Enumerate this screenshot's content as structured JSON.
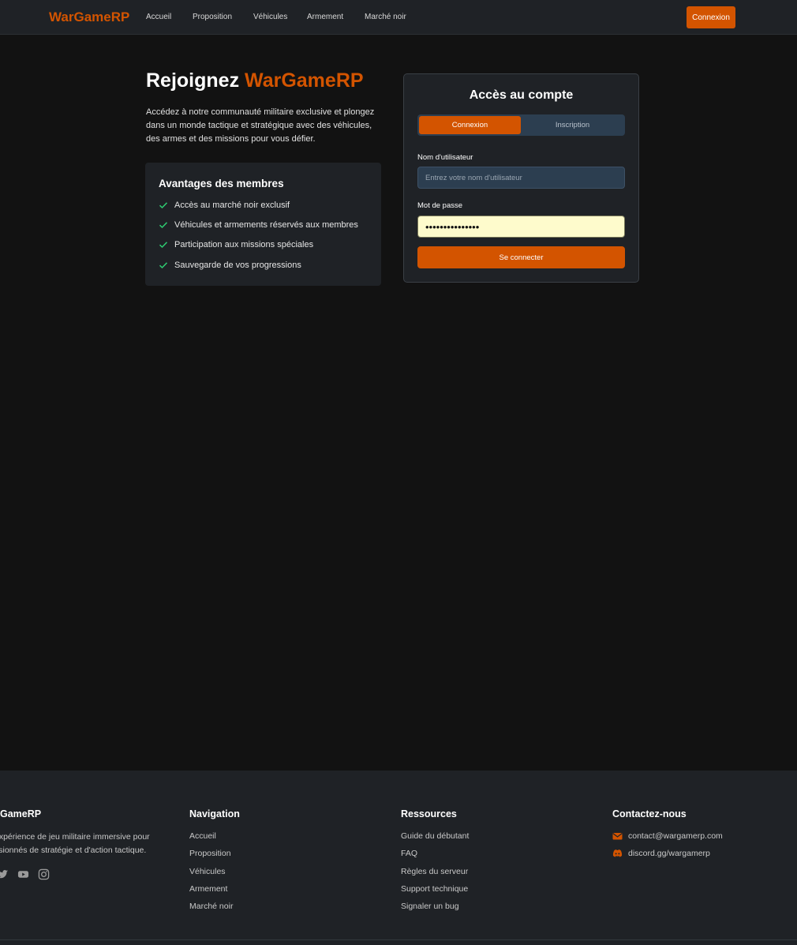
{
  "nav": {
    "brand": "WarGameRP",
    "links": [
      "Accueil",
      "Proposition",
      "Véhicules",
      "Armement",
      "Marché noir"
    ],
    "login_button": "Connexion"
  },
  "hero": {
    "title_prefix": "Rejoignez",
    "title_accent": "WarGameRP",
    "description": "Accédez à notre communauté militaire exclusive et plongez dans un monde tactique et stratégique avec des véhicules, des armes et des missions pour vous défier."
  },
  "benefits": {
    "title": "Avantages des membres",
    "items": [
      "Accès au marché noir exclusif",
      "Véhicules et armements réservés aux membres",
      "Participation aux missions spéciales",
      "Sauvegarde de vos progressions"
    ]
  },
  "login_card": {
    "title": "Accès au compte",
    "tab_login": "Connexion",
    "tab_register": "Inscription",
    "username_label": "Nom d'utilisateur",
    "username_placeholder": "Entrez votre nom d'utilisateur",
    "password_label": "Mot de passe",
    "password_value": "•••••••••••••••",
    "submit": "Se connecter"
  },
  "footer": {
    "brand": "GameRP",
    "description": "expérience de jeu militaire immersive pour ssionnés de stratégie et d'action tactique.",
    "navigation": {
      "title": "Navigation",
      "links": [
        "Accueil",
        "Proposition",
        "Véhicules",
        "Armement",
        "Marché noir"
      ]
    },
    "resources": {
      "title": "Ressources",
      "links": [
        "Guide du débutant",
        "FAQ",
        "Règles du serveur",
        "Support technique",
        "Signaler un bug"
      ]
    },
    "contact": {
      "title": "Contactez-nous",
      "email": "contact@wargamerp.com",
      "discord": "discord.gg/wargamerp"
    }
  },
  "colors": {
    "accent": "#d35400",
    "background": "#121212",
    "panel": "#1f2226",
    "check": "#2ecc71"
  }
}
